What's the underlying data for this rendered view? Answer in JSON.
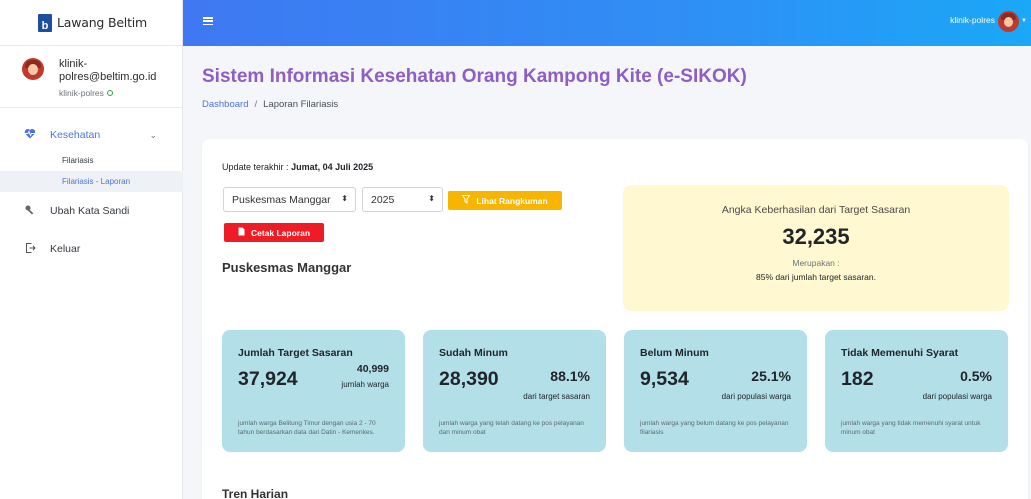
{
  "brand": {
    "logo_letter": "b",
    "name": "Lawang Beltim"
  },
  "user": {
    "email": "klinik-polres@beltim.go.id",
    "username": "klinik-polres"
  },
  "nav": {
    "kesehatan": "Kesehatan",
    "sub_items": [
      "Filariasis",
      "Filariasis - Laporan"
    ],
    "ubah_sandi": "Ubah Kata Sandi",
    "keluar": "Keluar"
  },
  "topbar": {
    "user": "klinik-polres"
  },
  "page": {
    "title": "Sistem Informasi Kesehatan Orang Kampong Kite (e-SIKOK)",
    "breadcrumb_home": "Dashboard",
    "breadcrumb_sep": "/",
    "breadcrumb_current": "Laporan Filariasis"
  },
  "report": {
    "update_label": "Update terakhir :",
    "update_date": "Jumat, 04 Juli 2025",
    "select_puskesmas": "Puskesmas Manggar",
    "select_year": "2025",
    "btn_rangkuman": "Lihat Rangkuman",
    "btn_cetak": "Cetak Laporan",
    "section_name": "Puskesmas Manggar",
    "tren_title": "Tren Harian"
  },
  "success": {
    "title": "Angka Keberhasilan dari Target Sasaran",
    "value": "32,235",
    "sub1": "Merupakan :",
    "sub2": "85% dari jumlah target sasaran."
  },
  "stats": [
    {
      "title": "Jumlah Target Sasaran",
      "big": "37,924",
      "right": "40,999",
      "right_sub": "jumlah warga",
      "desc": "jumlah warga Belitung Timur dengan usia 2 - 70 tahun berdasarkan data dari Datin - Kemenkes."
    },
    {
      "title": "Sudah Minum",
      "big": "28,390",
      "right": "88.1%",
      "right_sub": "dari target sasaran",
      "desc": "jumlah warga yang telah datang ke pos pelayanan dan minum obat"
    },
    {
      "title": "Belum Minum",
      "big": "9,534",
      "right": "25.1%",
      "right_sub": "dari populasi warga",
      "desc": "jumlah warga yang belum datang ke pos pelayanan filariasis"
    },
    {
      "title": "Tidak Memenuhi Syarat",
      "big": "182",
      "right": "0.5%",
      "right_sub": "dari populasi warga",
      "desc": "jumlah warga yang tidak memenuhi syarat untuk minum obat"
    }
  ],
  "colors": {
    "topbar": "#3f78f2",
    "title": "#8e5ec4",
    "accent": "#4e73df",
    "stat_bg": "#b2dfe8",
    "success_bg": "#fff8d0",
    "btn_yellow": "#f7b500",
    "btn_red": "#ee1c25"
  },
  "icons": {
    "menu": "hamburger-icon",
    "kesehatan": "heartbeat-icon",
    "key": "key-icon",
    "logout": "logout-icon",
    "filter": "filter-icon",
    "file": "file-icon"
  }
}
